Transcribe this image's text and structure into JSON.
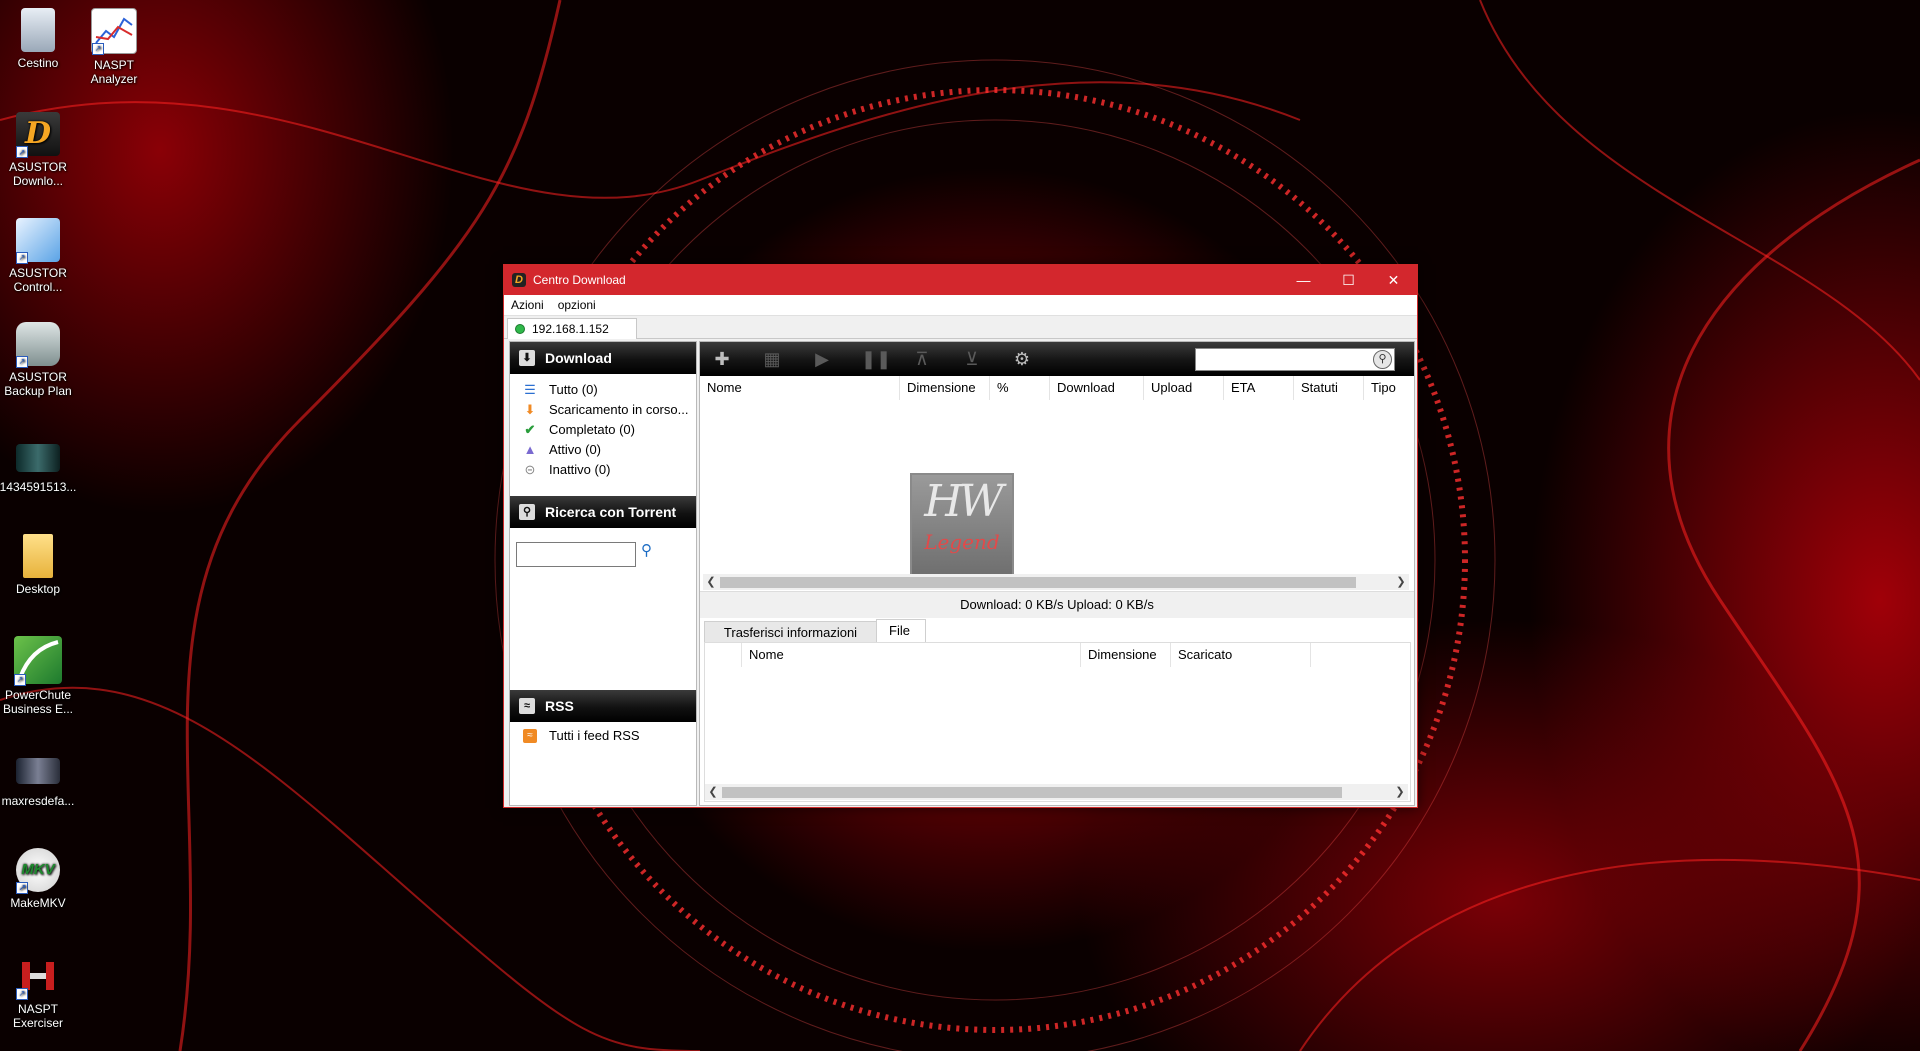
{
  "desktop": {
    "icons": [
      {
        "label": "Cestino",
        "icon": "recycle-bin-icon"
      },
      {
        "label": "NASPT Analyzer",
        "icon": "chart-icon"
      },
      {
        "label": "ASUSTOR Downlo...",
        "icon": "download-center-icon"
      },
      {
        "label": "ASUSTOR Control...",
        "icon": "control-center-icon"
      },
      {
        "label": "ASUSTOR Backup Plan",
        "icon": "backup-icon"
      },
      {
        "label": "1434591513...",
        "icon": "image-thumbnail-icon"
      },
      {
        "label": "Desktop",
        "icon": "folder-icon"
      },
      {
        "label": "PowerChute Business E...",
        "icon": "powerchute-icon"
      },
      {
        "label": "maxresdefa...",
        "icon": "image-thumbnail-icon"
      },
      {
        "label": "MakeMKV",
        "icon": "makemkv-icon"
      },
      {
        "label": "NASPT Exerciser",
        "icon": "dumbbell-icon"
      }
    ]
  },
  "window": {
    "title": "Centro Download",
    "menu": [
      "Azioni",
      "opzioni"
    ],
    "host_tab": "192.168.1.152",
    "accent": "#d3272d"
  },
  "left_panel": {
    "download_header": "Download",
    "filters": [
      {
        "label": "Tutto (0)",
        "icon": "list-icon"
      },
      {
        "label": "Scaricamento in corso...",
        "icon": "arrow-down-icon"
      },
      {
        "label": "Completato (0)",
        "icon": "checkmark-icon"
      },
      {
        "label": "Attivo (0)",
        "icon": "active-icon"
      },
      {
        "label": "Inattivo (0)",
        "icon": "inactive-icon"
      }
    ],
    "search_header": "Ricerca con Torrent",
    "search_value": "",
    "rss_header": "RSS",
    "rss_item": "Tutti i feed RSS"
  },
  "toolbar": {
    "buttons": [
      "add-icon",
      "trash-icon",
      "play-icon",
      "pause-icon",
      "move-top-icon",
      "move-bottom-icon",
      "gear-icon"
    ],
    "search_value": ""
  },
  "task_table": {
    "columns": [
      "Nome",
      "Dimensione",
      "%",
      "Download",
      "Upload",
      "ETA",
      "Statuti",
      "Tipo"
    ],
    "rows": []
  },
  "watermark": {
    "top": "HW",
    "bottom": "Legend"
  },
  "status": "Download: 0 KB/s  Upload: 0 KB/s",
  "details": {
    "tabs": [
      "Trasferisci informazioni",
      "File"
    ],
    "active_tab": "File",
    "columns": [
      "Nome",
      "Dimensione",
      "Scaricato"
    ]
  }
}
